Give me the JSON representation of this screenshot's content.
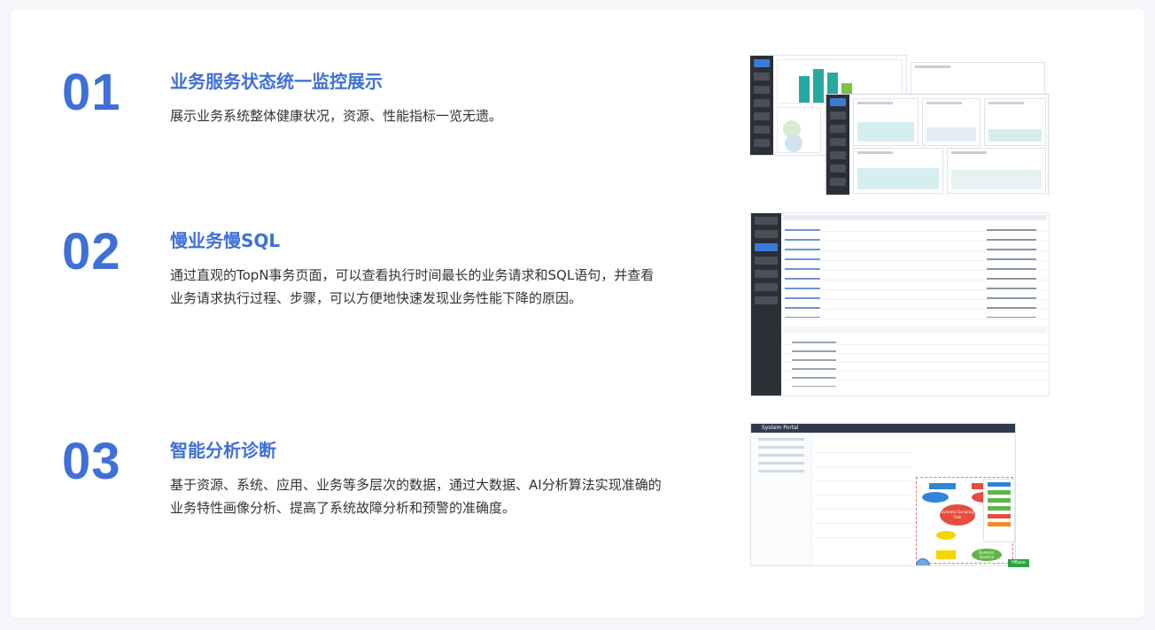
{
  "sections": [
    {
      "number": "01",
      "title": "业务服务状态统一监控展示",
      "description": "展示业务系统整体健康状况，资源、性能指标一览无遗。"
    },
    {
      "number": "02",
      "title": "慢业务慢SQL",
      "description": "通过直观的TopN事务页面，可以查看执行时间最长的业务请求和SQL语句，并查看业务请求执行过程、步骤，可以方便地快速发现业务性能下降的原因。"
    },
    {
      "number": "03",
      "title": "智能分析诊断",
      "description": "基于资源、系统、应用、业务等多层次的数据，通过大数据、AI分析算法实现准确的业务特性画像分析、提高了系统故障分析和预警的准确度。"
    }
  ],
  "screenshot3": {
    "header": "System Portal",
    "flow": [
      "Dynamic Sampling Task",
      "Dynamic baseline",
      "HBase"
    ]
  },
  "colors": {
    "accent": "#3f6fd8",
    "green": "#7cc242",
    "teal": "#27a9a2",
    "dark_sidebar": "#2b2f36",
    "red": "#e74c3c",
    "yellow": "#f5d400",
    "blue": "#2f86d6"
  }
}
